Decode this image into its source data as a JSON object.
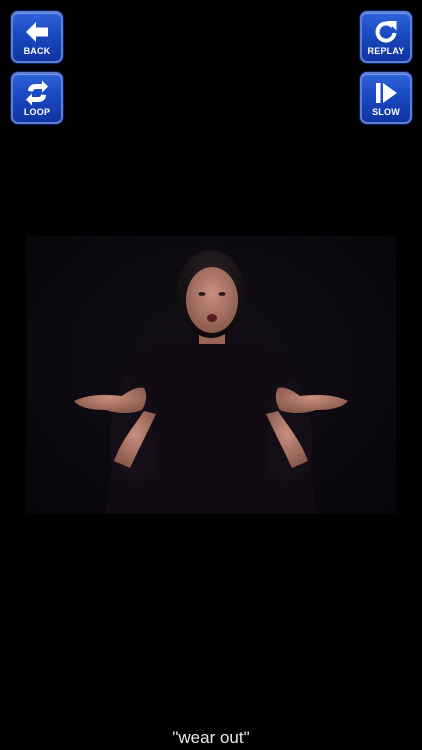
{
  "controls": {
    "back_label": "BACK",
    "loop_label": "LOOP",
    "replay_label": "REPLAY",
    "slow_label": "SLOW"
  },
  "icons": {
    "back": "left-arrow-icon",
    "loop": "loop-icon",
    "replay": "replay-icon",
    "slow": "slow-play-icon"
  },
  "colors": {
    "background": "#000000",
    "button": "#1a49c0",
    "button_border": "#5e7fd6",
    "caption_text": "#e8e8e8"
  },
  "caption": "\"wear out\""
}
